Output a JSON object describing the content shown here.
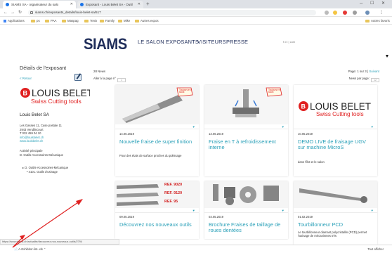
{
  "browser": {
    "tabs": [
      {
        "label": "SIAMS SA - organisateur du salo",
        "active": true,
        "favicon_color": "#1a73e8"
      },
      {
        "label": "Exposant - Louis Belet SA - Outil",
        "active": false,
        "favicon_color": "#1a73e8"
      }
    ],
    "url": "siams.ch/exposants_details/louis-belet-sa/517",
    "bookmarks": [
      "Applications",
      "ps",
      "PAA",
      "Maspag",
      "Tenix",
      "Family",
      "Mike",
      "Autres expos"
    ],
    "other_bookmarks": "Autres favoris"
  },
  "site": {
    "logo_text": "SIAMS",
    "nav": [
      "LE SALON",
      "EXPOSANTS",
      "VISITEURS",
      "PRESSE"
    ],
    "lang": "f  d  i  |  com"
  },
  "sidebar": {
    "title": "Détails de l'exposant",
    "back": "< Retour",
    "logo_main": "LOUIS BELET",
    "logo_sub": "Swiss Cutting tools",
    "company": "Louis Belet SA",
    "address": [
      "Les Gasses 11, Case postale 11",
      "2943 Vendlincourt",
      "T 032 459 04 10"
    ],
    "email": "info@louisbelet.ch",
    "website": "www.louisbelet.ch",
    "activity_label": "Activité principale",
    "activity_value": "D. Outils-Accessoires-Mécanique",
    "tree": [
      "D. Outils-Accessoires-Mécanique",
      "4101. Outils d'usinage"
    ]
  },
  "news": {
    "count": "28 News",
    "goto_label": "Aller à la page n°",
    "goto_value": "1",
    "pager_prefix": "Page: 1 sur 3 |",
    "pager_next": "Suivant",
    "perpage_label": "News par page:",
    "perpage_value": "12",
    "cards": [
      {
        "date": "14.06.2019",
        "title": "Nouvelle fraise de super finition",
        "desc": "Pour des états de surface proches du polissage"
      },
      {
        "date": "13.06.2019",
        "title": "Fraise en T à refroidissement interne",
        "desc": ""
      },
      {
        "date": "10.05.2019",
        "title": "DEMO LIVE de fraisage UGV sur machine MicroS",
        "desc": "dans l'îlot et le salon"
      },
      {
        "date": "09.05.2019",
        "title": "Découvrez nos nouveaux outils",
        "desc": "",
        "ref_labels": [
          "REF. 9020",
          "REF. 9120",
          "REF. 95"
        ]
      },
      {
        "date": "03.05.2019",
        "title": "Brochure Fraises de taillage de roues dentées",
        "desc": ""
      },
      {
        "date": "01.02.2019",
        "title": "Tourbillonneur PCD",
        "desc": "Le tourbillonneur diamant polycristallin (PCD) permet l'usinage de mécanismes très"
      }
    ],
    "badge_text": "Toujours en stock"
  },
  "status": {
    "hover_url": "https://www.siams.ch/actualite/decouvrez-nos-nouveaux-outils/2794",
    "download_item": "A-Exhibitor-list-.xls",
    "show_all": "Tout afficher"
  },
  "colors": {
    "accent": "#2aa0b8",
    "brand": "#1f2d5a",
    "ref_red": "#d22020",
    "annotation": "#e02020"
  }
}
